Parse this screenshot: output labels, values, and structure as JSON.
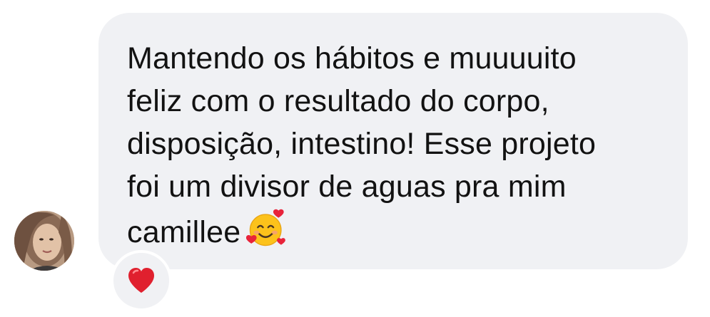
{
  "message": {
    "lines": [
      "Mantendo os hábitos e muuuuito",
      "feliz com o resultado do corpo,",
      "disposição, intestino! Esse projeto",
      "foi um divisor de aguas pra mim",
      "camillee"
    ],
    "trailing_emoji": "smiling-face-with-hearts-icon"
  },
  "reaction": {
    "emoji": "red-heart-icon"
  },
  "colors": {
    "bubble": "#f0f1f4",
    "text": "#121212",
    "heart": "#e0202e"
  }
}
